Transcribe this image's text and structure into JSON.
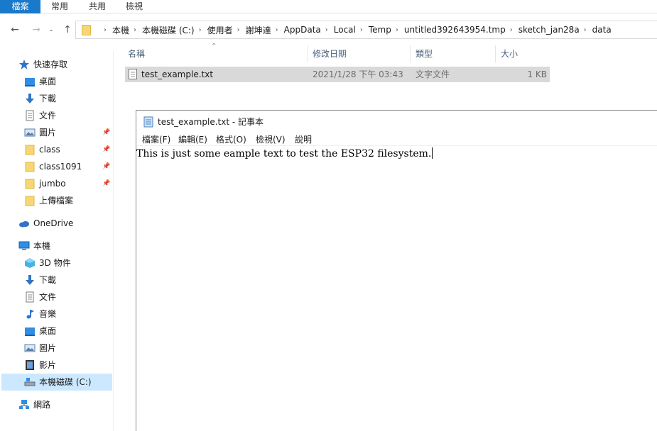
{
  "ribbon": {
    "tabs": [
      {
        "label": "檔案",
        "active": true
      },
      {
        "label": "常用",
        "active": false
      },
      {
        "label": "共用",
        "active": false
      },
      {
        "label": "檢視",
        "active": false
      }
    ],
    "accent_color": "#1979ca"
  },
  "address_bar": {
    "crumbs": [
      "本機",
      "本機磁碟 (C:)",
      "使用者",
      "謝坤達",
      "AppData",
      "Local",
      "Temp",
      "untitled392643954.tmp",
      "sketch_jan28a",
      "data"
    ]
  },
  "sidebar": {
    "quick_access": "快速存取",
    "quick_items": [
      {
        "label": "桌面",
        "icon": "desktop-icon",
        "pinned": true
      },
      {
        "label": "下載",
        "icon": "download-icon",
        "pinned": true
      },
      {
        "label": "文件",
        "icon": "document-icon",
        "pinned": true
      },
      {
        "label": "圖片",
        "icon": "pictures-icon",
        "pinned": true
      },
      {
        "label": "class",
        "icon": "folder-icon",
        "pinned": false
      },
      {
        "label": "class1091",
        "icon": "folder-icon",
        "pinned": false
      },
      {
        "label": "jumbo",
        "icon": "folder-icon",
        "pinned": false
      },
      {
        "label": "上傳檔案",
        "icon": "folder-icon",
        "pinned": false
      }
    ],
    "onedrive": "OneDrive",
    "this_pc": "本機",
    "pc_items": [
      {
        "label": "3D 物件",
        "icon": "3d-objects-icon"
      },
      {
        "label": "下載",
        "icon": "download-icon"
      },
      {
        "label": "文件",
        "icon": "document-icon"
      },
      {
        "label": "音樂",
        "icon": "music-icon"
      },
      {
        "label": "桌面",
        "icon": "desktop-icon"
      },
      {
        "label": "圖片",
        "icon": "pictures-icon"
      },
      {
        "label": "影片",
        "icon": "video-icon"
      },
      {
        "label": "本機磁碟 (C:)",
        "icon": "drive-icon",
        "selected": true
      }
    ],
    "network": "網路"
  },
  "file_list": {
    "columns": {
      "name": "名稱",
      "modified": "修改日期",
      "type": "類型",
      "size": "大小"
    },
    "rows": [
      {
        "name": "test_example.txt",
        "modified": "2021/1/28 下午 03:43",
        "type": "文字文件",
        "size": "1 KB"
      }
    ]
  },
  "notepad": {
    "title": "test_example.txt - 記事本",
    "menu": [
      "檔案(F)",
      "編輯(E)",
      "格式(O)",
      "檢視(V)",
      "說明"
    ],
    "content": "This is just some eample text to test the ESP32 filesystem."
  }
}
